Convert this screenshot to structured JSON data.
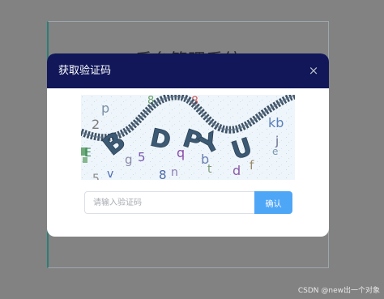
{
  "colors": {
    "overlay": "#828282",
    "header_bg": "#111759",
    "confirm_bg": "#4ea6f6",
    "panel_accent": "#2f7d74"
  },
  "login_panel": {
    "title": "后台管理系统"
  },
  "dialog": {
    "title": "获取验证码",
    "close_icon": "close-icon",
    "captcha": {
      "text": [
        "B",
        "D",
        "P",
        "Y",
        "U"
      ],
      "noise": [
        "p",
        "8",
        "8",
        "2",
        "kb",
        "j",
        "e",
        "E",
        "q",
        "g",
        "5",
        "b",
        "v",
        "8",
        "n",
        "t",
        "d",
        "f",
        "5"
      ]
    },
    "input": {
      "value": "",
      "placeholder": "请输入验证码"
    },
    "confirm_label": "确认"
  },
  "watermark": "CSDN @new出一个对象"
}
